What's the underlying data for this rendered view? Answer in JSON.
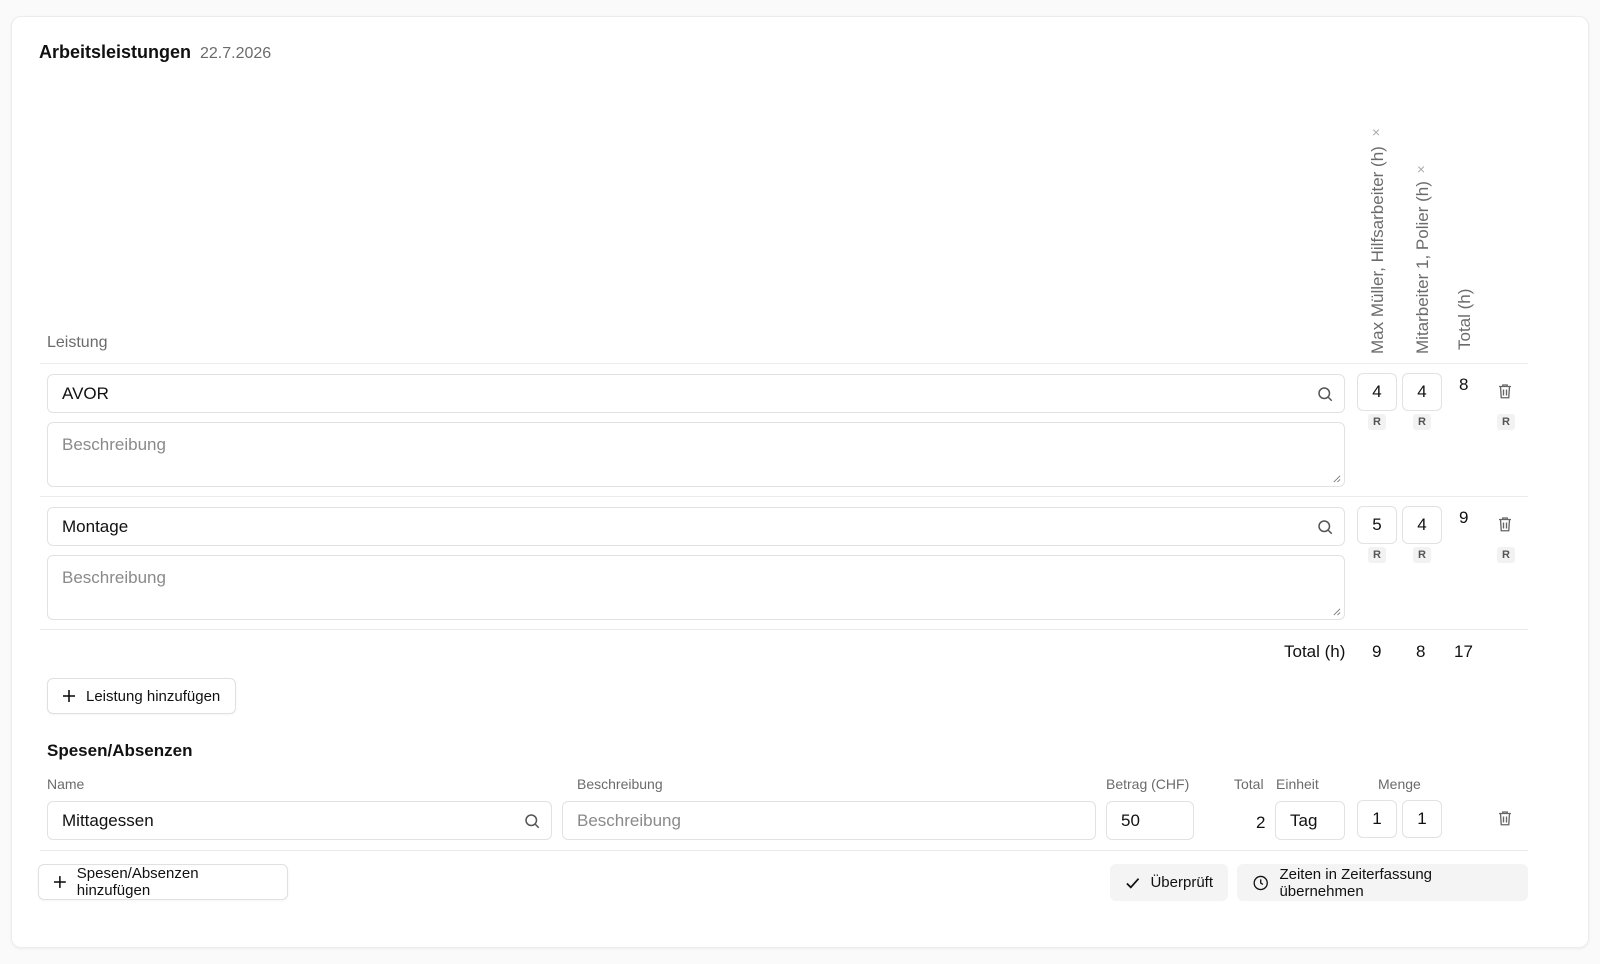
{
  "header": {
    "title": "Arbeitsleistungen",
    "date": "22.7.2026"
  },
  "leistungen": {
    "column_label": "Leistung",
    "employees": [
      {
        "label": "Max Müller, Hilfsarbeiter (h)",
        "remove": "×"
      },
      {
        "label": "Mitarbeiter 1, Polier (h)",
        "remove": "×"
      }
    ],
    "total_column": "Total (h)",
    "rows": [
      {
        "name": "AVOR",
        "description_placeholder": "Beschreibung",
        "hours": [
          "4",
          "4"
        ],
        "total": "8",
        "r": "R"
      },
      {
        "name": "Montage",
        "description_placeholder": "Beschreibung",
        "hours": [
          "5",
          "4"
        ],
        "total": "9",
        "r": "R"
      }
    ],
    "totals": {
      "label": "Total (h)",
      "values": [
        "9",
        "8"
      ],
      "grand": "17"
    },
    "add_button": "Leistung hinzufügen"
  },
  "spesen": {
    "title": "Spesen/Absenzen",
    "columns": {
      "name": "Name",
      "description": "Beschreibung",
      "amount": "Betrag (CHF)",
      "total": "Total",
      "unit": "Einheit",
      "quantity": "Menge"
    },
    "rows": [
      {
        "name": "Mittagessen",
        "description_placeholder": "Beschreibung",
        "amount": "50",
        "total": "2",
        "unit": "Tag",
        "quantities": [
          "1",
          "1"
        ]
      }
    ],
    "add_button": "Spesen/Absenzen hinzufügen"
  },
  "actions": {
    "reviewed": "Überprüft",
    "transfer": "Zeiten in Zeiterfassung übernehmen"
  }
}
